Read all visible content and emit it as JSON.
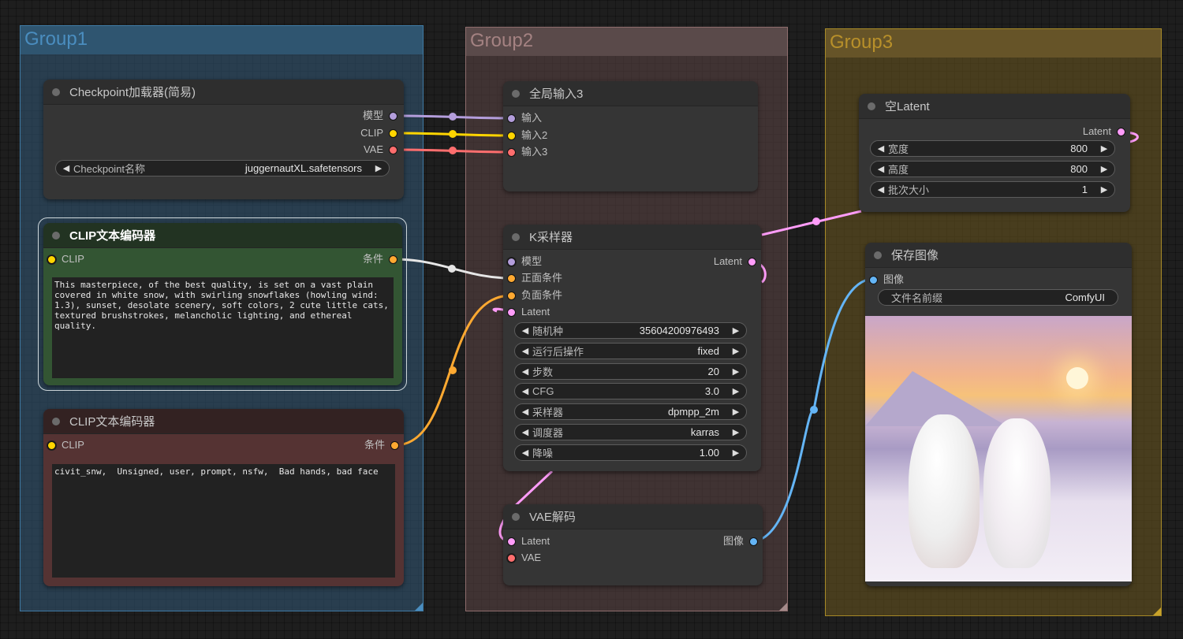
{
  "groups": [
    {
      "title": "Group1",
      "color": "#3f7aa4"
    },
    {
      "title": "Group2",
      "color": "#8e6d6d"
    },
    {
      "title": "Group3",
      "color": "#a78a28"
    }
  ],
  "checkpoint_loader": {
    "title": "Checkpoint加载器(简易)",
    "outputs": [
      "模型",
      "CLIP",
      "VAE"
    ],
    "widget": {
      "label": "Checkpoint名称",
      "value": "juggernautXL.safetensors"
    }
  },
  "clip_positive": {
    "title": "CLIP文本编码器",
    "input": "CLIP",
    "output": "条件",
    "text": "This masterpiece, of the best quality, is set on a vast plain covered in white snow, with swirling snowflakes (howling wind: 1.3), sunset, desolate scenery, soft colors, 2 cute little cats, textured brushstrokes, melancholic lighting, and ethereal quality."
  },
  "clip_negative": {
    "title": "CLIP文本编码器",
    "input": "CLIP",
    "output": "条件",
    "text": "civit_snw,  Unsigned, user, prompt, nsfw,  Bad hands, bad face"
  },
  "global_input": {
    "title": "全局输入3",
    "inputs": [
      "输入",
      "输入2",
      "输入3"
    ]
  },
  "ksampler": {
    "title": "K采样器",
    "inputs": [
      "模型",
      "正面条件",
      "负面条件",
      "Latent"
    ],
    "output": "Latent",
    "widgets": [
      {
        "label": "随机种",
        "value": "35604200976493"
      },
      {
        "label": "运行后操作",
        "value": "fixed"
      },
      {
        "label": "步数",
        "value": "20"
      },
      {
        "label": "CFG",
        "value": "3.0"
      },
      {
        "label": "采样器",
        "value": "dpmpp_2m"
      },
      {
        "label": "调度器",
        "value": "karras"
      },
      {
        "label": "降噪",
        "value": "1.00"
      }
    ]
  },
  "vae_decode": {
    "title": "VAE解码",
    "inputs": [
      "Latent",
      "VAE"
    ],
    "output": "图像"
  },
  "empty_latent": {
    "title": "空Latent",
    "output": "Latent",
    "widgets": [
      {
        "label": "宽度",
        "value": "800"
      },
      {
        "label": "高度",
        "value": "800"
      },
      {
        "label": "批次大小",
        "value": "1"
      }
    ]
  },
  "save_image": {
    "title": "保存图像",
    "input": "图像",
    "widget": {
      "label": "文件名前缀",
      "value": "ComfyUI"
    },
    "preview_alt": "Two white cats sitting in snow at sunset"
  },
  "colors": {
    "model": "#b39ddb",
    "clip": "#ffd500",
    "vae": "#ff6e6e",
    "conditioning": "#ffa931",
    "latent": "#ff9cf9",
    "image": "#64b5f6"
  }
}
